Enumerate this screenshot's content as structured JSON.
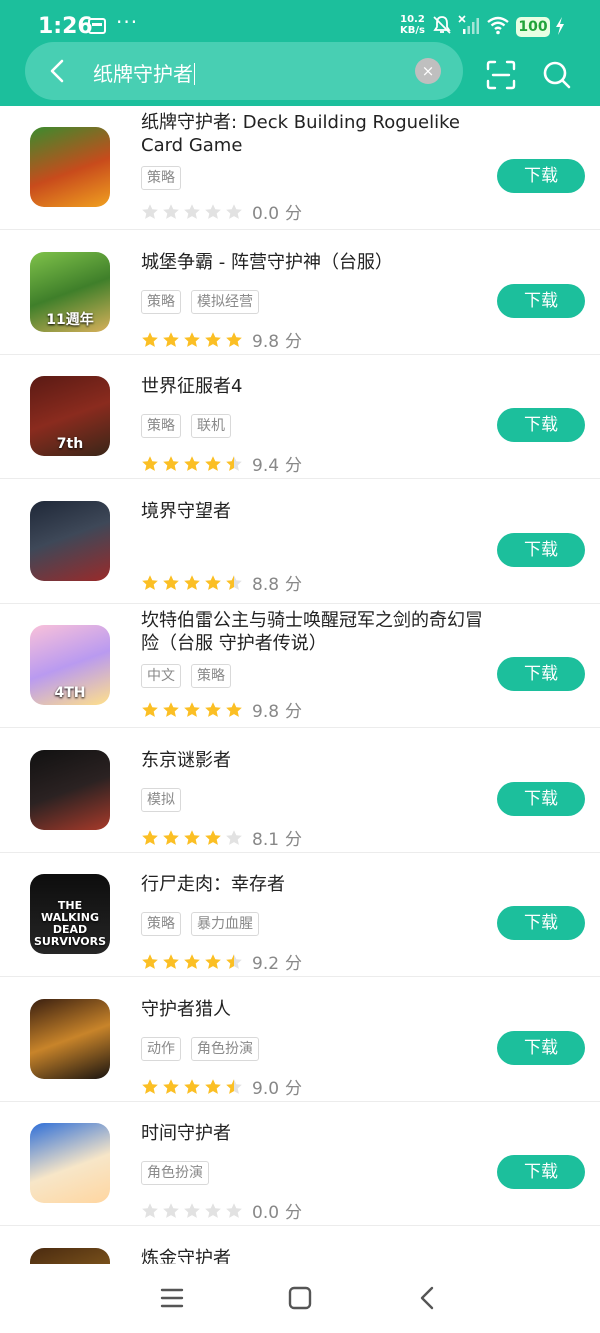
{
  "status_bar": {
    "time": "1:26",
    "dots": "···",
    "net_speed_value": "10.2",
    "net_speed_unit": "KB/s",
    "battery": "100"
  },
  "search": {
    "query": "纸牌守护者",
    "clear_label": "×"
  },
  "colors": {
    "accent": "#1cbf9c",
    "star_on": "#fbbf24",
    "star_off": "#e2e2e2"
  },
  "download_label": "下载",
  "score_unit": "分",
  "results": [
    {
      "title": "纸牌守护者: Deck Building Roguelike Card Game",
      "tags": [
        "策略"
      ],
      "stars": 0,
      "score": "0.0"
    },
    {
      "title": "城堡争霸 - 阵营守护神（台服）",
      "tags": [
        "策略",
        "模拟经营"
      ],
      "stars": 5,
      "score": "9.8",
      "icon_text": "11週年"
    },
    {
      "title": "世界征服者4",
      "tags": [
        "策略",
        "联机"
      ],
      "stars": 4.5,
      "score": "9.4",
      "icon_text": "7th"
    },
    {
      "title": "境界守望者",
      "tags": [],
      "stars": 4.5,
      "score": "8.8"
    },
    {
      "title": "坎特伯雷公主与骑士唤醒冠军之剑的奇幻冒险（台服 守护者传说）",
      "tags": [
        "中文",
        "策略"
      ],
      "stars": 5,
      "score": "9.8",
      "icon_text": "4TH"
    },
    {
      "title": "东京谜影者",
      "tags": [
        "模拟"
      ],
      "stars": 4,
      "score": "8.1"
    },
    {
      "title": "行尸走肉：幸存者",
      "tags": [
        "策略",
        "暴力血腥"
      ],
      "stars": 4.5,
      "score": "9.2",
      "icon_text": "THE WALKING DEAD SURVIVORS"
    },
    {
      "title": "守护者猎人",
      "tags": [
        "动作",
        "角色扮演"
      ],
      "stars": 4.5,
      "score": "9.0"
    },
    {
      "title": "时间守护者",
      "tags": [
        "角色扮演"
      ],
      "stars": 0,
      "score": "0.0"
    },
    {
      "title": "炼金守护者",
      "tags": [],
      "stars": 0,
      "score": ""
    }
  ]
}
